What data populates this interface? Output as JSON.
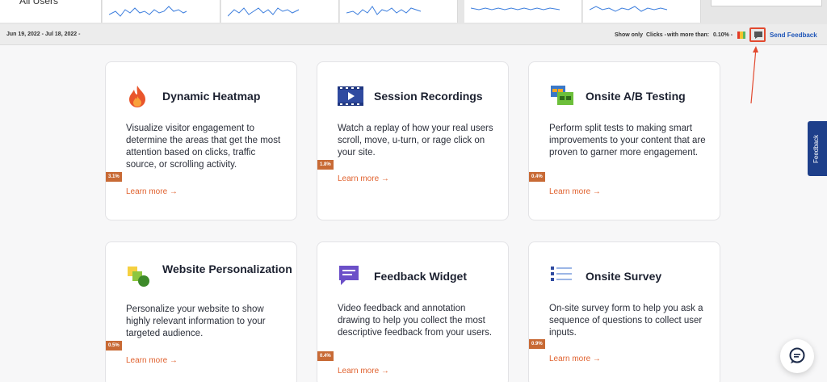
{
  "header": {
    "segment_label": "All Users"
  },
  "toolbar": {
    "date_range": "Jun 19, 2022 - Jul 18, 2022 -",
    "show_only": "Show only",
    "clicks": "Clicks -",
    "with_more_than": "with more than:",
    "threshold": "0.10% -",
    "send_feedback": "Send Feedback"
  },
  "colors": {
    "accent_orange": "#e0622f",
    "badge": "#c86a35",
    "brand_blue": "#1e3f8a",
    "highlight_red": "#e2492f"
  },
  "cards": [
    {
      "title": "Dynamic Heatmap",
      "icon": "flame-icon",
      "description": "Visualize visitor engagement to determine the areas that get the most attention based on clicks, traffic source, or scrolling activity.",
      "badge": "3.1%",
      "link": "Learn more →"
    },
    {
      "title": "Session Recordings",
      "icon": "video-icon",
      "description": "Watch a replay of how your real users scroll, move, u-turn, or rage click on your site.",
      "badge": "1.8%",
      "link": "Learn more →"
    },
    {
      "title": "Onsite A/B Testing",
      "icon": "ab-testing-icon",
      "description": "Perform split tests to making smart improvements to your content that are proven to garner more engagement.",
      "badge": "0.4%",
      "link": "Learn more →"
    },
    {
      "title": "Website Personalization",
      "icon": "personalization-icon",
      "description": "Personalize your website to show highly relevant information to your targeted audience.",
      "badge": "0.5%",
      "link": "Learn more →"
    },
    {
      "title": "Feedback Widget",
      "icon": "chat-bubble-icon",
      "description": "Video feedback and annotation drawing to help you collect the most descriptive feedback from your users.",
      "badge": "0.4%",
      "link": "Learn more →"
    },
    {
      "title": "Onsite Survey",
      "icon": "list-icon",
      "description": "On-site survey form to help you ask a sequence of questions to collect user inputs.",
      "badge": "0.9%",
      "link": "Learn more →"
    }
  ],
  "side_tab": {
    "label": "Feedback"
  }
}
